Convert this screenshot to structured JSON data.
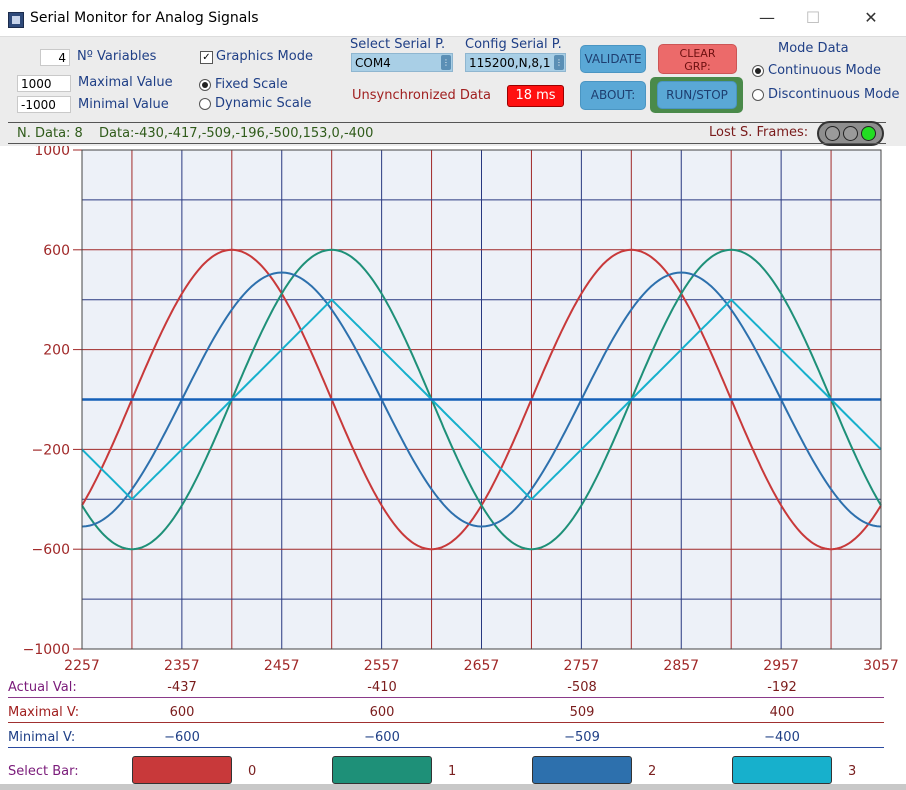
{
  "window": {
    "title": "Serial Monitor for Analog Signals",
    "minimize": "—",
    "maximize": "☐",
    "close": "✕"
  },
  "controls": {
    "num_variables": "4",
    "num_variables_label": "Nº Variables",
    "max_value": "1000",
    "max_value_label": "Maximal Value",
    "min_value": "-1000",
    "min_value_label": "Minimal Value",
    "graphics_mode_label": "Graphics Mode",
    "graphics_mode_checked": true,
    "fixed_scale_label": "Fixed Scale",
    "dynamic_scale_label": "Dynamic Scale",
    "scale_selected": "fixed",
    "serial_port_label": "Select Serial P.",
    "serial_port_value": "COM4",
    "serial_config_label": "Config Serial P.",
    "serial_config_value": "115200,N,8,1",
    "unsync_label": "Unsynchronized Data",
    "unsync_time": "18 ms",
    "validate_button": "VALIDATE",
    "clear_button_line1": "CLEAR",
    "clear_button_line2": "GRP:",
    "about_button": "ABOUT:",
    "runstop_button": "RUN/STOP",
    "mode_data_label": "Mode Data",
    "continuous_mode_label": "Continuous Mode",
    "discontinuous_mode_label": "Discontinuous Mode",
    "mode_selected": "continuous"
  },
  "status": {
    "n_data": "N. Data: 8",
    "data_values": "Data:-430,-417,-509,-196,-500,153,0,-400",
    "lost_frames_label": "Lost S. Frames:"
  },
  "chart_data": {
    "type": "line",
    "xlim": [
      2257,
      3057
    ],
    "ylim": [
      -1000,
      1000
    ],
    "x_ticks": [
      "2257",
      "2357",
      "2457",
      "2557",
      "2657",
      "2757",
      "2857",
      "2957",
      "3057"
    ],
    "y_ticks": [
      "1000",
      "600",
      "200",
      "−200",
      "−600",
      "−1000"
    ],
    "grid": true,
    "colors": {
      "s0": "#c8393a",
      "s1": "#1e9078",
      "s2": "#2d70ad",
      "s3": "#17b0cc",
      "flat": "#1560b8"
    },
    "series": [
      {
        "values": {
          "kind": "sine",
          "amplitude": 600,
          "period": 400,
          "peak_x": 2407
        }
      },
      {
        "values": {
          "kind": "sine",
          "amplitude": 600,
          "period": 400,
          "peak_x": 2507
        }
      },
      {
        "values": {
          "kind": "sine",
          "amplitude": 509,
          "period": 400,
          "peak_x": 2457
        }
      },
      {
        "values": {
          "kind": "triangle",
          "amplitude": 400,
          "period": 400,
          "peak_x": 2507
        }
      },
      {
        "values": {
          "kind": "constant",
          "value": 0
        }
      }
    ]
  },
  "info": {
    "actual_label": "Actual Val:",
    "actual_values": [
      "-437",
      "-410",
      "-508",
      "-192"
    ],
    "max_label": "Maximal V:",
    "max_values": [
      "600",
      "600",
      "509",
      "400"
    ],
    "min_label": "Minimal V:",
    "min_values": [
      "−600",
      "−600",
      "−509",
      "−400"
    ],
    "select_bar_label": "Select Bar:",
    "bars": [
      {
        "color": "#c8393a",
        "number": "0"
      },
      {
        "color": "#1e9078",
        "number": "1"
      },
      {
        "color": "#2d70ad",
        "number": "2"
      },
      {
        "color": "#17b0cc",
        "number": "3"
      }
    ]
  }
}
